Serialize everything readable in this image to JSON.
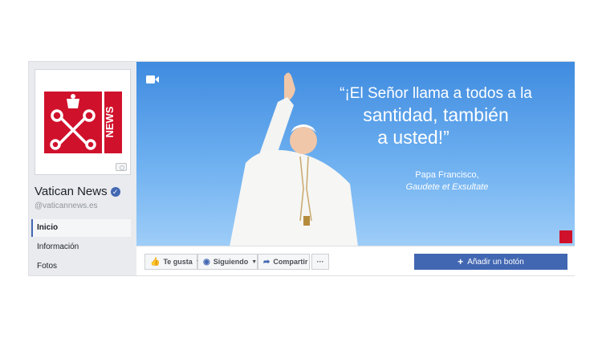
{
  "page": {
    "name": "Vatican News",
    "handle": "@vaticannews.es",
    "logo_text": "NEWS"
  },
  "nav": {
    "items": [
      {
        "label": "Inicio",
        "active": true
      },
      {
        "label": "Información"
      },
      {
        "label": "Fotos"
      }
    ]
  },
  "cover": {
    "quote_line1": "“¡El Señor llama a todos a la",
    "quote_line2": "santidad, también",
    "quote_line3": "a usted!”",
    "author": "Papa Francisco,",
    "source": "Gaudete et Exsultate"
  },
  "actions": {
    "like_label": "Te gusta",
    "follow_label": "Siguiendo",
    "share_label": "Compartir",
    "more_label": "···",
    "add_button_label": "Añadir un botón"
  },
  "colors": {
    "fb_blue": "#4267b2",
    "vatican_red": "#d0112b"
  }
}
